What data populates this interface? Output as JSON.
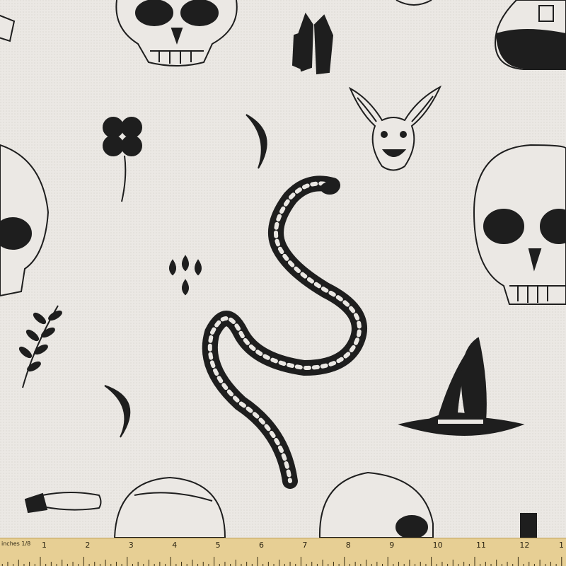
{
  "scene": {
    "subject": "halloween-pattern-fabric",
    "background_color": "#ebe8e4",
    "ink_color": "#1e1e1e"
  },
  "ruler": {
    "unit_label": "inches 1/8",
    "numbers": [
      "1",
      "2",
      "3",
      "4",
      "5",
      "6",
      "7",
      "8",
      "9",
      "10",
      "11",
      "12",
      "1"
    ],
    "color": "#e7cf94"
  },
  "motifs": [
    "skull-icon",
    "crystal-icon",
    "potion-bottle-icon",
    "bat-icon",
    "clover-icon",
    "crescent-moon-icon",
    "snake-icon",
    "blood-drops-icon",
    "fern-leaf-icon",
    "witch-hat-icon",
    "severed-finger-icon"
  ]
}
